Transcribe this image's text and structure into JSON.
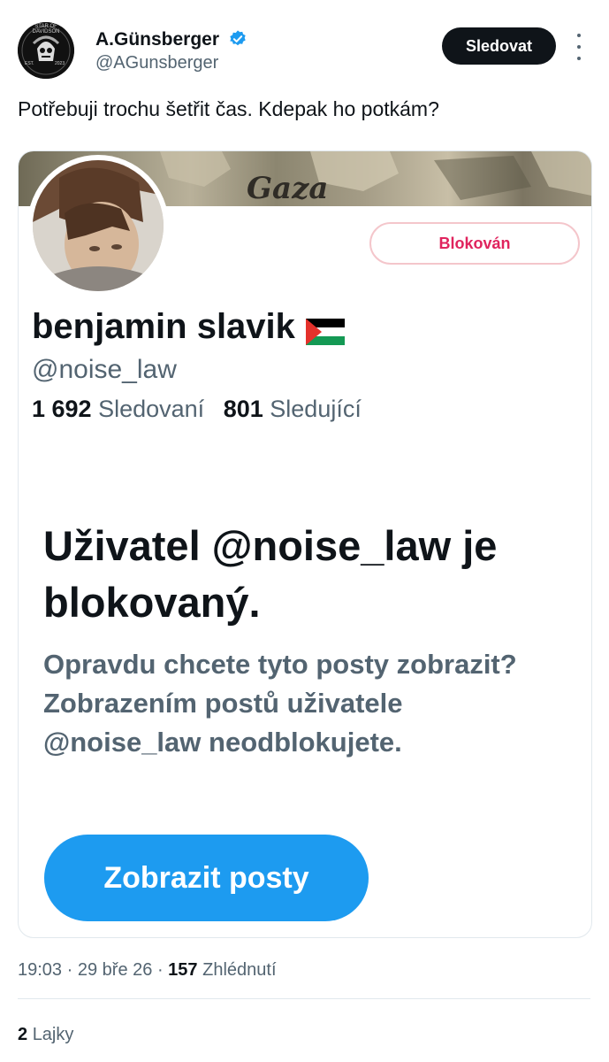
{
  "author": {
    "name": "A.Günsberger",
    "handle": "@AGunsberger",
    "verified": true,
    "avatar_text_top": "STAR OF DAVIDSON",
    "avatar_text_left": "EST.",
    "avatar_text_right": "2023"
  },
  "follow_label": "Sledovat",
  "tweet_text": "Potřebuji trochu šetřit čas. Kdepak ho potkám?",
  "card": {
    "banner_text": "Gaza",
    "blocked_label": "Blokován",
    "profile_name": "benjamin slavik",
    "profile_handle": "@noise_law",
    "following_count": "1 692",
    "following_label": "Sledovaní",
    "followers_count": "801",
    "followers_label": "Sledující",
    "blocked_title": "Uživatel @noise_law je blokovaný.",
    "blocked_description": "Opravdu chcete tyto posty zobrazit? Zobrazením postů uživatele @noise_law neodblokujete.",
    "show_posts_label": "Zobrazit posty"
  },
  "meta": {
    "time": "19:03",
    "sep1": "·",
    "date": "29 bře 26",
    "sep2": "·",
    "views_count": "157",
    "views_label": "Zhlédnutí"
  },
  "likes": {
    "count": "2",
    "label": "Lajky"
  },
  "colors": {
    "accent": "#1d9bf0",
    "blocked_red": "#e0245e",
    "secondary_text": "#536471"
  }
}
